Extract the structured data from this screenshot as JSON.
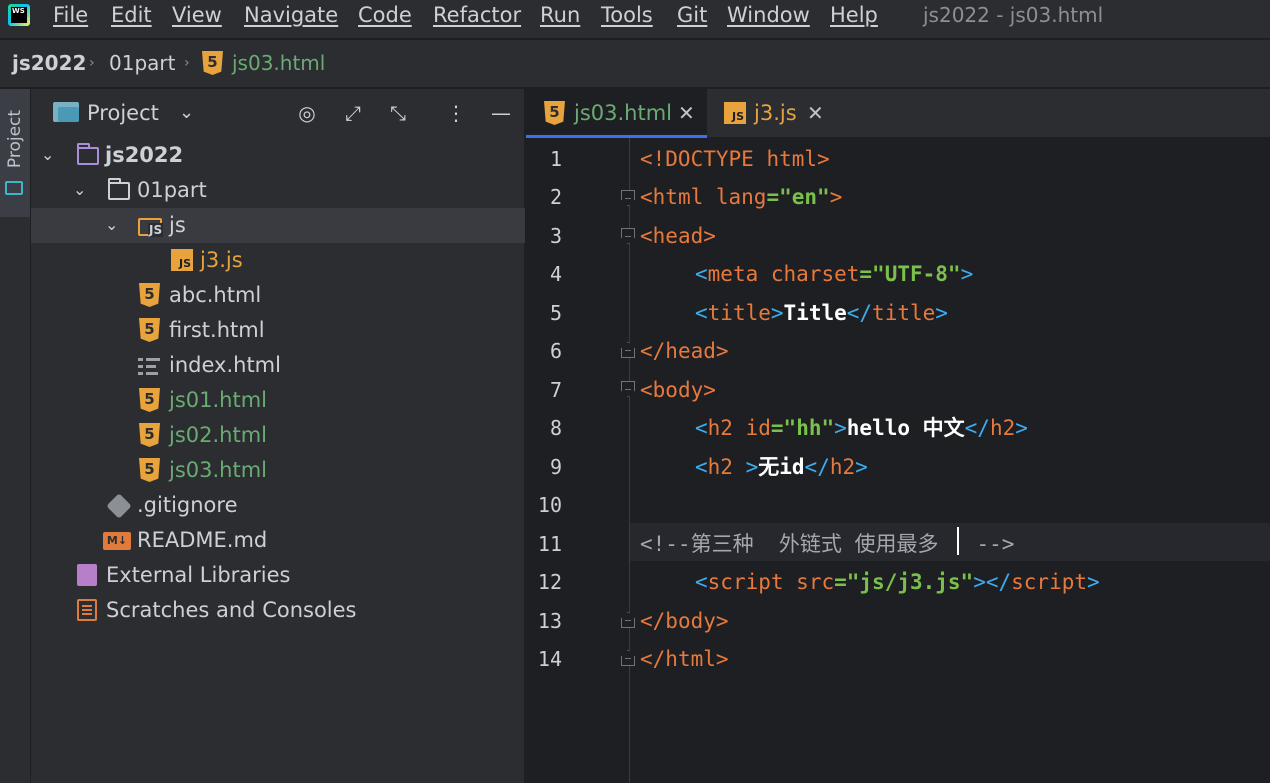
{
  "app": {
    "logo_text": "WS"
  },
  "menu": [
    "File",
    "Edit",
    "View",
    "Navigate",
    "Code",
    "Refactor",
    "Run",
    "Tools",
    "Git",
    "Window",
    "Help"
  ],
  "window_title": "js2022 - js03.html",
  "breadcrumb": {
    "project": "js2022",
    "folder": "01part",
    "file": "js03.html"
  },
  "tool_strip": {
    "project_label": "Project"
  },
  "project_panel": {
    "title": "Project",
    "tree": [
      {
        "label": "js2022"
      },
      {
        "label": "01part"
      },
      {
        "label": "js"
      },
      {
        "label": "j3.js"
      },
      {
        "label": "abc.html"
      },
      {
        "label": "first.html"
      },
      {
        "label": "index.html"
      },
      {
        "label": "js01.html"
      },
      {
        "label": "js02.html"
      },
      {
        "label": "js03.html"
      },
      {
        "label": ".gitignore"
      },
      {
        "label": "README.md"
      },
      {
        "label": "External Libraries"
      },
      {
        "label": "Scratches and Consoles"
      }
    ]
  },
  "tabs": [
    {
      "label": "js03.html",
      "active": true
    },
    {
      "label": "j3.js",
      "active": false
    }
  ],
  "editor": {
    "current_line": 11,
    "lines": [
      {
        "num": "1"
      },
      {
        "num": "2"
      },
      {
        "num": "3"
      },
      {
        "num": "4"
      },
      {
        "num": "5"
      },
      {
        "num": "6"
      },
      {
        "num": "7"
      },
      {
        "num": "8"
      },
      {
        "num": "9"
      },
      {
        "num": "10"
      },
      {
        "num": "11"
      },
      {
        "num": "12"
      },
      {
        "num": "13"
      },
      {
        "num": "14"
      }
    ],
    "code": {
      "l1": {
        "a": "<!DOCTYPE ",
        "b": "html",
        "c": ">"
      },
      "l2": {
        "a": "<",
        "b": "html ",
        "c": "lang",
        "d": "=",
        "e": "\"en\"",
        "f": ">"
      },
      "l3": {
        "a": "<",
        "b": "head",
        "c": ">"
      },
      "l4": {
        "a": "<",
        "b": "meta ",
        "c": "charset",
        "d": "=",
        "e": "\"UTF-8\"",
        "f": ">"
      },
      "l5": {
        "a": "<",
        "b": "title",
        "c": ">",
        "d": "Title",
        "e": "</",
        "f": "title",
        "g": ">"
      },
      "l6": {
        "a": "</",
        "b": "head",
        "c": ">"
      },
      "l7": {
        "a": "<",
        "b": "body",
        "c": ">"
      },
      "l8": {
        "a": "<",
        "b": "h2 ",
        "c": "id",
        "d": "=",
        "e": "\"hh\"",
        "f": ">",
        "g": "hello 中文",
        "h": "</",
        "i": "h2",
        "j": ">"
      },
      "l9": {
        "a": "<",
        "b": "h2 ",
        "c": ">",
        "d": "无id",
        "e": "</",
        "f": "h2",
        "g": ">"
      },
      "l11": {
        "a": "<!--第三种  外链式 使用最多",
        "b": "   -->"
      },
      "l12": {
        "a": "<",
        "b": "script ",
        "c": "src",
        "d": "=",
        "e": "\"js/j3.js\"",
        "f": "></",
        "g": "script",
        "h": ">"
      },
      "l13": {
        "a": "</",
        "b": "body",
        "c": ">"
      },
      "l14": {
        "a": "</",
        "b": "html",
        "c": ">"
      }
    }
  }
}
